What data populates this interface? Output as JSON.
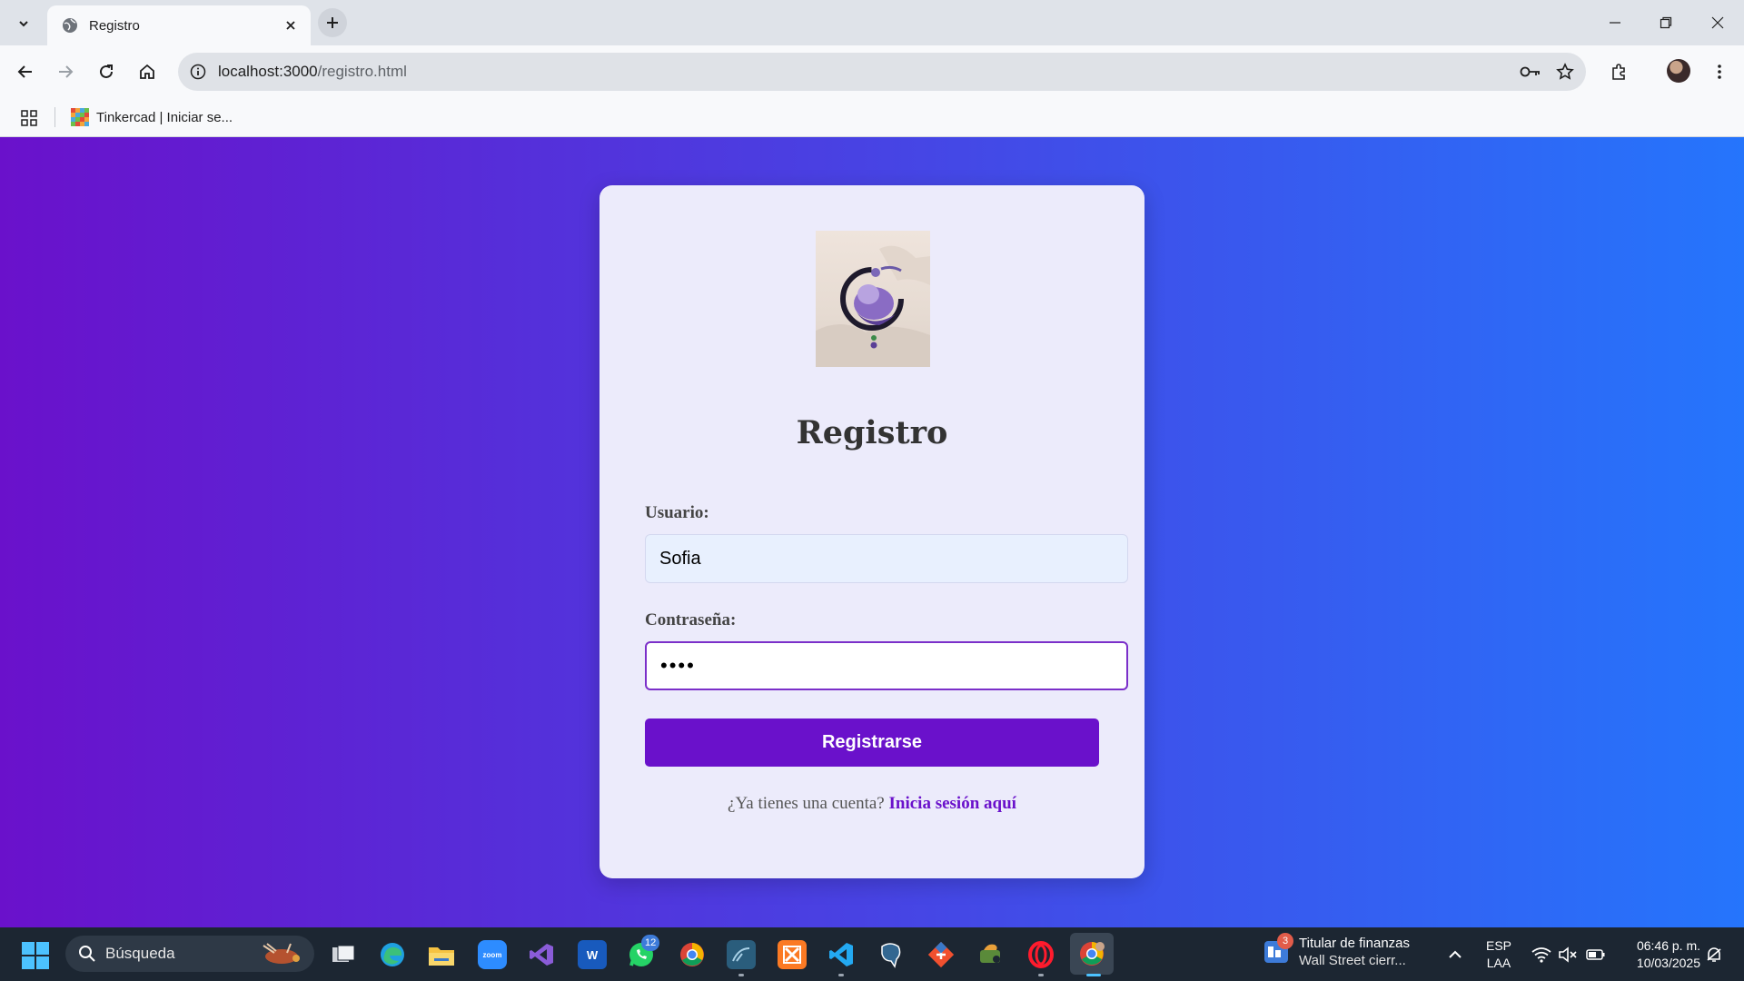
{
  "browser": {
    "tab_title": "Registro",
    "url_host": "localhost:3000",
    "url_path": "/registro.html",
    "bookmark_label": "Tinkercad | Iniciar se..."
  },
  "page": {
    "title": "Registro",
    "username_label": "Usuario:",
    "username_value": "Sofia",
    "password_label": "Contraseña:",
    "password_masked": "••••",
    "submit_label": "Registrarse",
    "login_prompt": "¿Ya tienes una cuenta?",
    "login_link": "Inicia sesión aquí",
    "colors": {
      "gradient_start": "#6a11cb",
      "gradient_end": "#2575fc",
      "accent": "#6a11cb",
      "card_bg": "#ecebfb"
    }
  },
  "taskbar": {
    "search_placeholder": "Búsqueda",
    "whatsapp_badge": "12",
    "news_badge": "3",
    "news_title": "Titular de finanzas",
    "news_subtitle": "Wall Street cierr...",
    "lang_line1": "ESP",
    "lang_line2": "LAA",
    "time": "06:46 p. m.",
    "date": "10/03/2025",
    "apps": [
      "task-view",
      "edge",
      "file-explorer",
      "zoom",
      "visual-studio",
      "word",
      "whatsapp",
      "chrome",
      "mysql-workbench",
      "xampp",
      "vscode",
      "postgresql",
      "git",
      "java",
      "opera",
      "chrome-active"
    ]
  }
}
